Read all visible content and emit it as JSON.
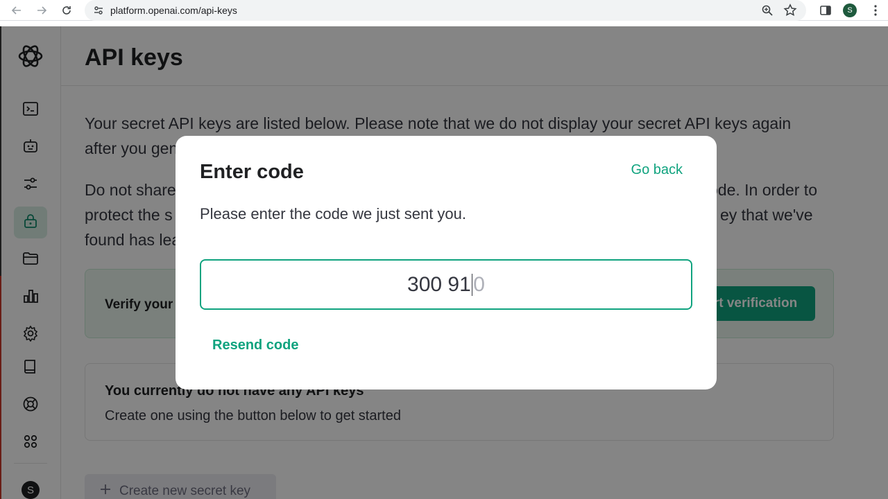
{
  "browser": {
    "url": "platform.openai.com/api-keys",
    "profile_initial": "S"
  },
  "sidebar": {
    "items": [
      {
        "icon": "terminal-icon",
        "label": "Playground"
      },
      {
        "icon": "assistant-robot-icon",
        "label": "Assistants"
      },
      {
        "icon": "sliders-icon",
        "label": "Fine-tuning"
      },
      {
        "icon": "lock-icon",
        "label": "API keys",
        "active": true
      },
      {
        "icon": "folder-icon",
        "label": "Files"
      },
      {
        "icon": "bar-chart-icon",
        "label": "Usage"
      },
      {
        "icon": "gear-icon",
        "label": "Settings"
      },
      {
        "icon": "book-icon",
        "label": "Documentation"
      },
      {
        "icon": "help-lifebuoy-icon",
        "label": "Help"
      },
      {
        "icon": "apps-grid-icon",
        "label": "Apps"
      }
    ],
    "user_initial": "S"
  },
  "header": {
    "title": "API keys"
  },
  "main": {
    "para1_line1": "Your secret API keys are listed below. Please note that we do not display your secret API keys again",
    "para1_line2": "after you gen",
    "para2_line1_left": "Do not share",
    "para2_line1_right": "ode. In order to",
    "para2_line2_left": "protect the s",
    "para2_line2_right": "ey that we've",
    "para2_line3_left": "found has lea",
    "verify_text": "Verify your",
    "verify_button": "rt verification",
    "empty_title": "You currently do not have any API keys",
    "empty_subtitle": "Create one using the button below to get started",
    "create_button": "Create new secret key"
  },
  "modal": {
    "title": "Enter code",
    "go_back": "Go back",
    "description": "Please enter the code we just sent you.",
    "code_typed": "300 91",
    "code_placeholder_rest": "0",
    "resend": "Resend code"
  },
  "colors": {
    "accent": "#10a37f",
    "overlay": "rgba(0,0,0,0.48)"
  }
}
